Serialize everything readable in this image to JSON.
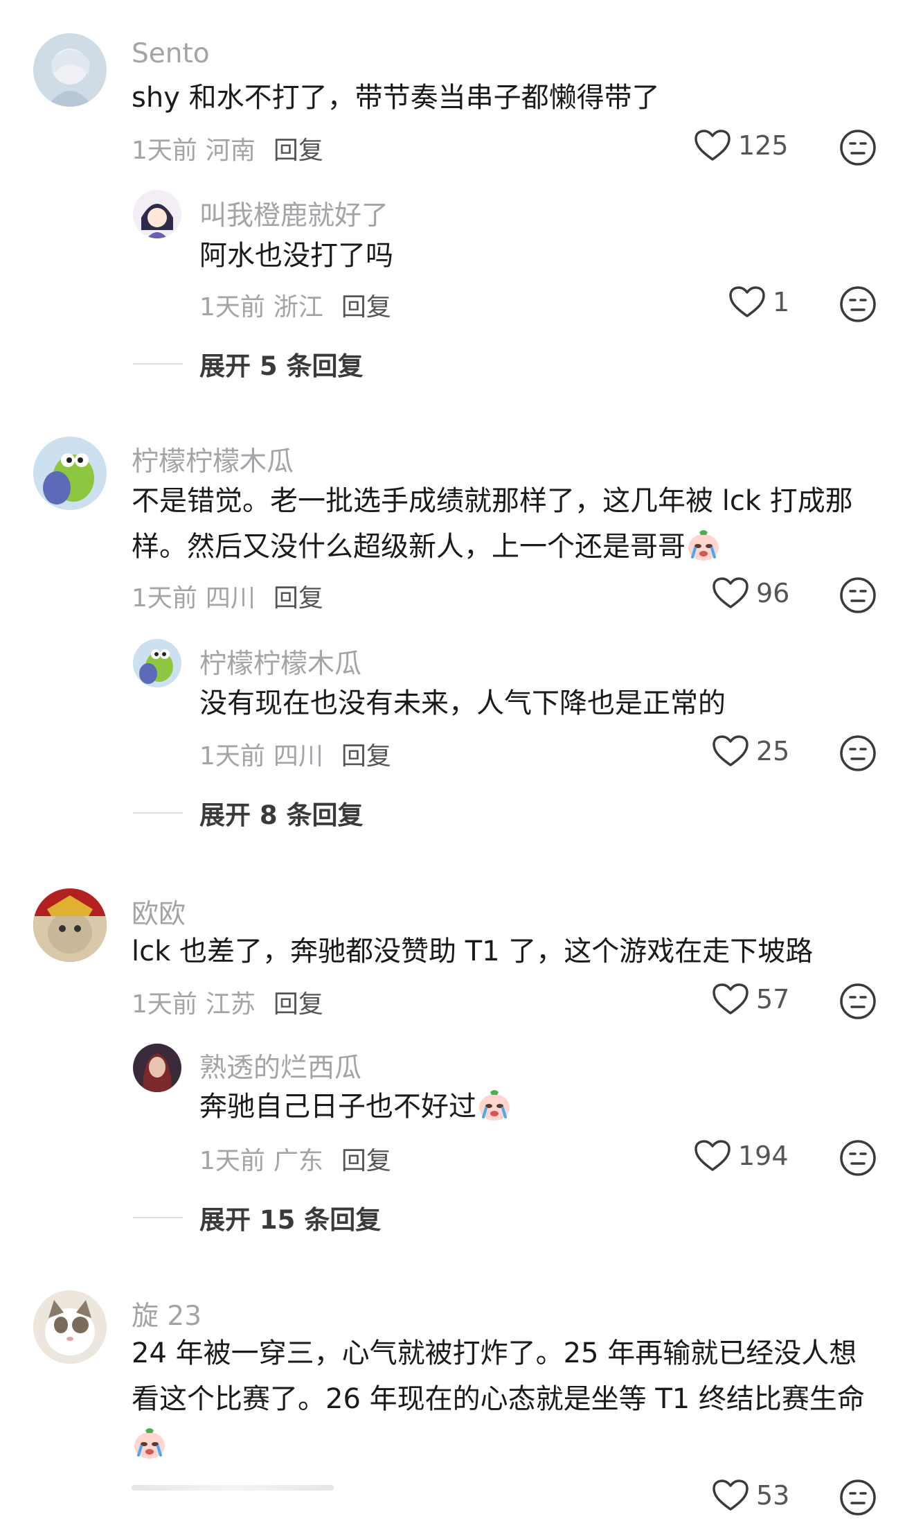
{
  "reply_label": "回复",
  "comments": [
    {
      "name": "Sento",
      "text": "shy 和水不打了，带节奏当串子都懒得带了",
      "time": "1天前",
      "location": "河南",
      "likes": "125",
      "reply": {
        "name": "叫我橙鹿就好了",
        "text": "阿水也没打了吗",
        "time": "1天前",
        "location": "浙江",
        "likes": "1"
      },
      "expand": "展开 5 条回复"
    },
    {
      "name": "柠檬柠檬木瓜",
      "text_line1": "不是错觉。老一批选手成绩就那样了，这几年被 lck 打成那",
      "text_line2": "样。然后又没什么超级新人，上一个还是哥哥",
      "time": "1天前",
      "location": "四川",
      "likes": "96",
      "reply": {
        "name": "柠檬柠檬木瓜",
        "text": "没有现在也没有未来，人气下降也是正常的",
        "time": "1天前",
        "location": "四川",
        "likes": "25"
      },
      "expand": "展开 8 条回复"
    },
    {
      "name": "欧欧",
      "text": "lck 也差了，奔驰都没赞助 T1 了，这个游戏在走下坡路",
      "time": "1天前",
      "location": "江苏",
      "likes": "57",
      "reply": {
        "name": "熟透的烂西瓜",
        "text": "奔驰自己日子也不好过",
        "time": "1天前",
        "location": "广东",
        "likes": "194"
      },
      "expand": "展开 15 条回复"
    },
    {
      "name": "旋 23",
      "text_line1": "24 年被一穿三，心气就被打炸了。25 年再输就已经没人想",
      "text_line2": "看这个比赛了。26 年现在的心态就是坐等 T1 终结比赛生命",
      "likes": "53"
    }
  ],
  "icons": {
    "heart": "heart-icon",
    "dislike": "meh-face-icon",
    "emoji": "crying-face-emoji"
  }
}
